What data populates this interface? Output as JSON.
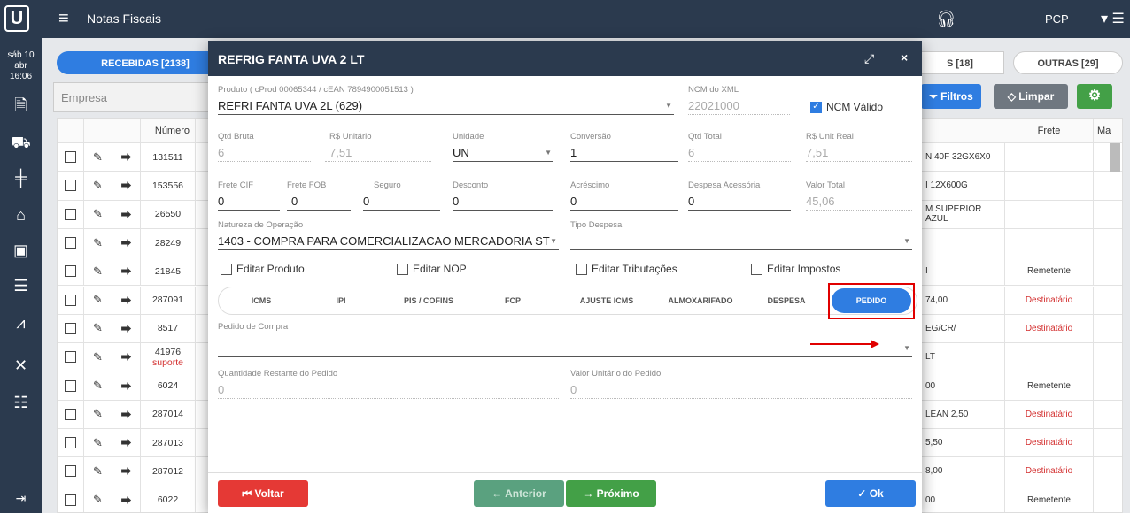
{
  "app": {
    "title": "Notas Fiscais",
    "user": "PCP",
    "date": "sáb 10 abr",
    "time": "16:06",
    "logo": "U"
  },
  "sidebar": {
    "icons": [
      "document-icon",
      "truck-icon",
      "signpost-icon",
      "warehouse-icon",
      "id-card-icon",
      "sliders-icon",
      "chart-icon",
      "tools-icon",
      "list-icon",
      "logout-icon"
    ]
  },
  "tabs": {
    "recebidas": "RECEBIDAS [2138]",
    "partial": "S [18]",
    "outras": "OUTRAS [29]"
  },
  "filters": {
    "empresa_placeholder": "Empresa",
    "filtros": "Filtros",
    "limpar": "Limpar"
  },
  "table": {
    "headers": {
      "numero": "Número",
      "frete": "Frete",
      "ma": "Ma"
    },
    "rows": [
      {
        "numero": "131511",
        "sub": "",
        "desc": "N 40F 32GX6X0",
        "frete": ""
      },
      {
        "numero": "153556",
        "sub": "",
        "desc": "I 12X600G",
        "frete": ""
      },
      {
        "numero": "26550",
        "sub": "",
        "desc": "M SUPERIOR AZUL",
        "frete": ""
      },
      {
        "numero": "28249",
        "sub": "",
        "desc": "",
        "frete": ""
      },
      {
        "numero": "21845",
        "sub": "",
        "desc": "I",
        "frete": "Remetente"
      },
      {
        "numero": "287091",
        "sub": "",
        "desc": "74,00",
        "frete": "Destinatário"
      },
      {
        "numero": "8517",
        "sub": "",
        "desc": "EG/CR/",
        "frete": "Destinatário"
      },
      {
        "numero": "41976",
        "sub": "suporte",
        "desc": "LT",
        "frete": ""
      },
      {
        "numero": "6024",
        "sub": "",
        "desc": "00",
        "frete": "Remetente"
      },
      {
        "numero": "287014",
        "sub": "",
        "desc": "LEAN 2,50",
        "frete": "Destinatário"
      },
      {
        "numero": "287013",
        "sub": "",
        "desc": "5,50",
        "frete": "Destinatário"
      },
      {
        "numero": "287012",
        "sub": "",
        "desc": "8,00",
        "frete": "Destinatário"
      },
      {
        "numero": "6022",
        "sub": "",
        "desc": "00",
        "frete": "Remetente"
      }
    ]
  },
  "modal": {
    "title": "REFRIG FANTA UVA 2 LT",
    "produto": {
      "label": "Produto ( cProd 00065344 / cEAN 7894900051513 )",
      "value": "REFRI FANTA UVA 2L (629)"
    },
    "ncm": {
      "label": "NCM do XML",
      "value": "22021000",
      "valido": "NCM Válido"
    },
    "qtd_bruta": {
      "label": "Qtd Bruta",
      "value": "6"
    },
    "unitario": {
      "label": "R$ Unitário",
      "value": "7,51"
    },
    "unidade": {
      "label": "Unidade",
      "value": "UN"
    },
    "conversao": {
      "label": "Conversão",
      "value": "1"
    },
    "qtd_total": {
      "label": "Qtd Total",
      "value": "6"
    },
    "unit_real": {
      "label": "R$ Unit Real",
      "value": "7,51"
    },
    "frete_cif": {
      "label": "Frete CIF",
      "value": "0"
    },
    "frete_fob": {
      "label": "Frete FOB",
      "value": "0"
    },
    "seguro": {
      "label": "Seguro",
      "value": "0"
    },
    "desconto": {
      "label": "Desconto",
      "value": "0"
    },
    "acrescimo": {
      "label": "Acréscimo",
      "value": "0"
    },
    "despesa_acessoria": {
      "label": "Despesa Acessória",
      "value": "0"
    },
    "valor_total": {
      "label": "Valor Total",
      "value": "45,06"
    },
    "natureza": {
      "label": "Natureza de Operação",
      "value": "1403 - COMPRA PARA COMERCIALIZACAO MERCADORIA ST"
    },
    "tipo_despesa": {
      "label": "Tipo Despesa",
      "value": ""
    },
    "checks": {
      "produto": "Editar Produto",
      "nop": "Editar NOP",
      "tributacoes": "Editar Tributações",
      "impostos": "Editar Impostos"
    },
    "tabs": [
      "ICMS",
      "IPI",
      "PIS / COFINS",
      "FCP",
      "AJUSTE ICMS",
      "ALMOXARIFADO",
      "DESPESA",
      "PEDIDO"
    ],
    "pedido_compra": {
      "label": "Pedido de Compra",
      "value": ""
    },
    "qtd_restante": {
      "label": "Quantidade Restante do Pedido",
      "value": "0"
    },
    "valor_unit_pedido": {
      "label": "Valor Unitário do Pedido",
      "value": "0"
    },
    "buttons": {
      "voltar": "Voltar",
      "anterior": "Anterior",
      "proximo": "Próximo",
      "ok": "Ok"
    }
  },
  "colors": {
    "navy": "#2b3a4e",
    "blue": "#2f7de1",
    "red": "#e53935",
    "green": "#43a047",
    "teal": "#5aa17f",
    "gray": "#6f7780"
  }
}
